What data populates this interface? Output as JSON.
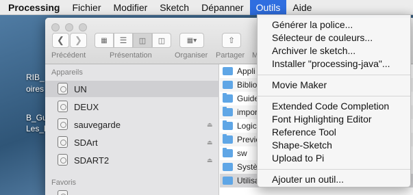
{
  "menubar": {
    "app": "Processing",
    "items": [
      "Fichier",
      "Modifier",
      "Sketch",
      "Dépanner",
      "Outils",
      "Aide"
    ],
    "active": "Outils"
  },
  "desktop": {
    "labels": [
      "RIB_",
      "oires",
      "B_Gu",
      "Les_l"
    ]
  },
  "finder": {
    "toolbar": {
      "back_label": "Précédent",
      "view_label": "Présentation",
      "arrange_label": "Organiser",
      "share_label": "Partager",
      "more_label": "M"
    },
    "sidebar": {
      "devices_heading": "Appareils",
      "devices": [
        {
          "label": "UN",
          "selected": true,
          "eject": false
        },
        {
          "label": "DEUX",
          "selected": false,
          "eject": false
        },
        {
          "label": "sauvegarde",
          "selected": false,
          "eject": true
        },
        {
          "label": "SDArt",
          "selected": false,
          "eject": true
        },
        {
          "label": "SDART2",
          "selected": false,
          "eject": true
        }
      ],
      "favorites_heading": "Favoris"
    },
    "files": [
      {
        "name": "Appli",
        "icon": "app-folder-icon"
      },
      {
        "name": "Biblio",
        "icon": "library-folder-icon"
      },
      {
        "name": "Guide",
        "icon": "folder-icon"
      },
      {
        "name": "impor",
        "icon": "folder-icon"
      },
      {
        "name": "Logic",
        "icon": "folder-icon"
      },
      {
        "name": "Previe",
        "icon": "folder-icon"
      },
      {
        "name": "sw",
        "icon": "folder-icon"
      },
      {
        "name": "Systè",
        "icon": "system-folder-icon"
      },
      {
        "name": "Utilisa",
        "icon": "users-folder-icon"
      }
    ]
  },
  "outils_menu": {
    "group1": [
      "Générer la police...",
      "Sélecteur de couleurs...",
      "Archiver le sketch...",
      "Installer \"processing-java\"..."
    ],
    "group2": [
      "Movie Maker"
    ],
    "group3": [
      "Extended Code Completion",
      "Font Highlighting Editor",
      "Reference Tool",
      "Shape-Sketch",
      "Upload to Pi"
    ],
    "group4": [
      "Ajouter un outil..."
    ]
  },
  "colors": {
    "menu_highlight": "#2f6ee0",
    "folder_blue": "#5fa6e6"
  }
}
